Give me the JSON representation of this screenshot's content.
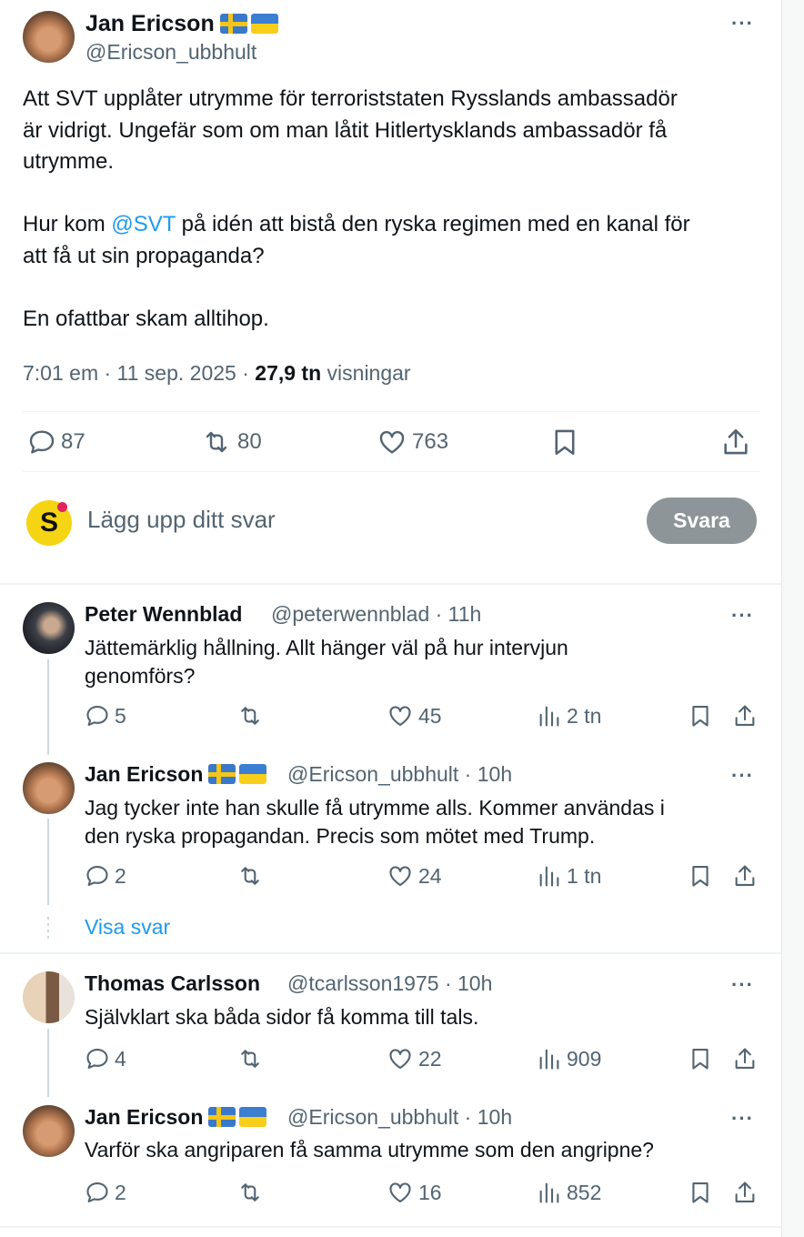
{
  "main_tweet": {
    "author_name": "Jan Ericson",
    "author_handle": "@Ericson_ubbhult",
    "more_label": "···",
    "text_line1": "Att SVT upplåter utrymme för terroriststaten Rysslands ambassadör",
    "text_line2": "är vidrigt. Ungefär som om man låtit Hitlertysklands ambassadör få",
    "text_line3": "utrymme.",
    "text_p2_before": "Hur kom ",
    "text_p2_mention": "@SVT",
    "text_p2_after": " på idén att bistå den ryska regimen med en kanal för",
    "text_p2_line2": "att få ut sin propaganda?",
    "text_p3": "En ofattbar skam alltihop.",
    "timestamp": "7:01 em · 11 sep. 2025 · ",
    "views_count": "27,9 tn",
    "views_label": " visningar",
    "replies": "87",
    "reposts": "80",
    "likes": "763"
  },
  "composer": {
    "avatar_letter": "S",
    "placeholder": "Lägg upp ditt svar",
    "button_label": "Svara"
  },
  "replies": [
    {
      "name": "Peter Wennblad",
      "handle": "@peterwennblad · 11h",
      "line1": "Jättemärklig hållning. Allt hänger väl på hur intervjun",
      "line2": "genomförs?",
      "replies": "5",
      "reposts": "",
      "likes": "45",
      "views": "2 tn"
    },
    {
      "name": "Jan Ericson",
      "handle": "@Ericson_ubbhult · 10h",
      "line1": "Jag tycker inte han skulle få utrymme alls. Kommer användas i",
      "line2": "den ryska propagandan. Precis som mötet med Trump.",
      "replies": "2",
      "reposts": "",
      "likes": "24",
      "views": "1 tn"
    },
    {
      "name": "Thomas Carlsson",
      "handle": "@tcarlsson1975 · 10h",
      "line1": "Självklart ska båda sidor få komma till tals.",
      "line2": "",
      "replies": "4",
      "reposts": "",
      "likes": "22",
      "views": "909"
    },
    {
      "name": "Jan Ericson",
      "handle": "@Ericson_ubbhult · 10h",
      "line1": "Varför ska angriparen få samma utrymme som den angripne?",
      "line2": "",
      "replies": "2",
      "reposts": "",
      "likes": "16",
      "views": "852"
    }
  ],
  "show_replies_label": "Visa svar",
  "icons": [
    "reply-icon",
    "repost-icon",
    "like-icon",
    "views-icon",
    "bookmark-icon",
    "share-icon",
    "more-icon",
    "sweden-flag-icon",
    "ukraine-flag-icon"
  ],
  "colors": {
    "link": "#1d9bf0",
    "muted": "#536471",
    "reply_button": "#8e9598",
    "composer_avatar": "#f5d414",
    "notification_dot": "#e0245e"
  }
}
